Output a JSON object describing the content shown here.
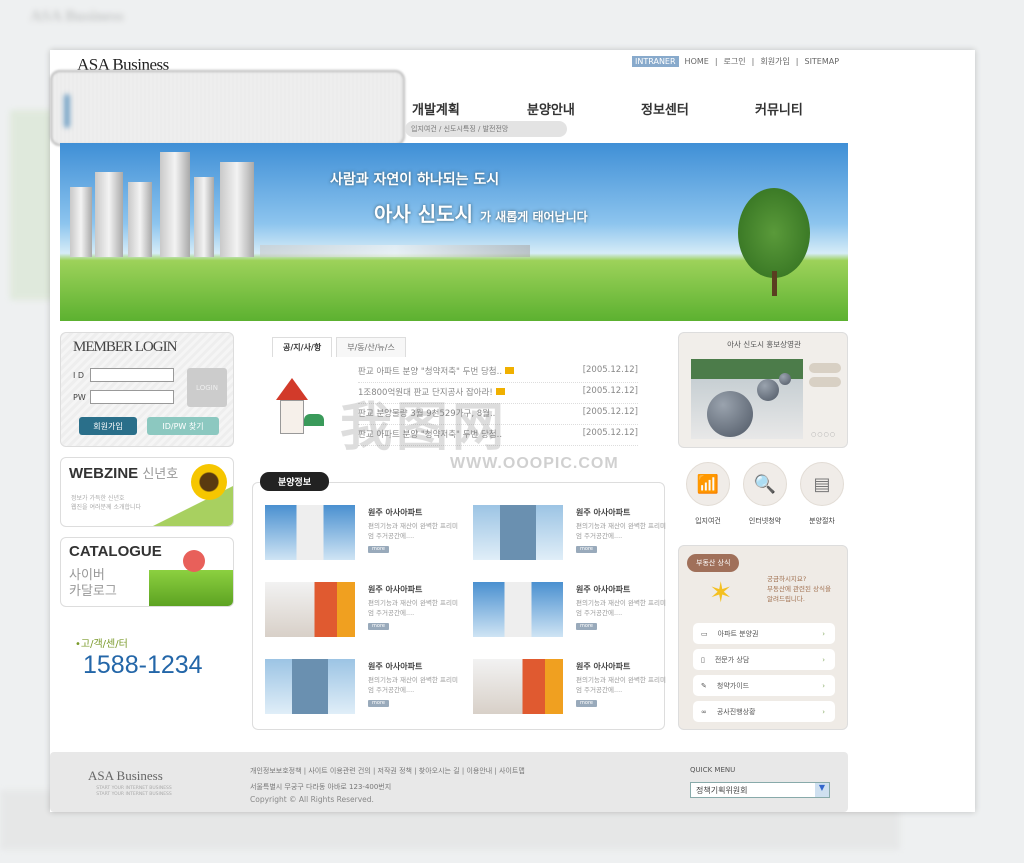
{
  "header": {
    "logo": "ASA Business",
    "top_links": [
      "INTRANER",
      "HOME",
      "로그인",
      "회원가입",
      "SITEMAP"
    ],
    "nav": [
      "개발계획",
      "분양안내",
      "정보센터",
      "커뮤니티"
    ],
    "subnav": "입지여건 / 신도시특징 / 발전전망"
  },
  "banner": {
    "line1": "사람과 자연이 하나되는 도시",
    "line2_big": "아사 신도시",
    "line2_small": "가 새롭게 태어납니다"
  },
  "login": {
    "title": "MEMBER LOGIN",
    "id_label": "I D",
    "pw_label": "PW",
    "login_button": "LOGIN",
    "join_button": "회원가입",
    "find_button": "ID/PW 찾기"
  },
  "webzine": {
    "title": "WEBZINE",
    "sub": "신년호",
    "desc1": "정보가 가득한 신년호",
    "desc2": "웹진을 여러분께 소개합니다"
  },
  "catalogue": {
    "title": "CATALOGUE",
    "sub1": "사이버",
    "sub2": "카달로그"
  },
  "callcenter": {
    "label": "•고/객/센/터",
    "phone": "1588-1234"
  },
  "notice": {
    "tabs": [
      "공/지/사/항",
      "부/동/산/뉴/스"
    ],
    "items": [
      {
        "title": "판교 아파트 분양 \"청약저축\" 두번 당첨..",
        "date": "[2005.12.12]",
        "new": true
      },
      {
        "title": "1조800억원대 판교 단지공사 잡아라!",
        "date": "[2005.12.12]",
        "new": true
      },
      {
        "title": "판교 분양물량 3월 9천529가구, 8월..",
        "date": "[2005.12.12]",
        "new": false
      },
      {
        "title": "판교 아파트 분양 \"청약저축\" 두번 당첨..",
        "date": "[2005.12.12]",
        "new": false
      }
    ]
  },
  "bunyang": {
    "label": "분양정보",
    "items": [
      {
        "title": "원주 아사아파트",
        "desc": "편의기능과 재산이 완벽한 프리미엄 주거공간에....",
        "btn": "more",
        "img": "building"
      },
      {
        "title": "원주 아사아파트",
        "desc": "편의기능과 재산이 완벽한 프리미엄 주거공간에....",
        "btn": "more",
        "img": "glass"
      },
      {
        "title": "원주 아사아파트",
        "desc": "편의기능과 재산이 완벽한 프리미엄 주거공간에....",
        "btn": "more",
        "img": "interior"
      },
      {
        "title": "원주 아사아파트",
        "desc": "편의기능과 재산이 완벽한 프리미엄 주거공간에....",
        "btn": "more",
        "img": "building"
      },
      {
        "title": "원주 아사아파트",
        "desc": "편의기능과 재산이 완벽한 프리미엄 주거공간에....",
        "btn": "more",
        "img": "glass"
      },
      {
        "title": "원주 아사아파트",
        "desc": "편의기능과 재산이 완벽한 프리미엄 주거공간에....",
        "btn": "more",
        "img": "interior"
      }
    ]
  },
  "promo": {
    "title": "아사 신도시 홍보상영관",
    "dots": "○○○○"
  },
  "quick_icons": [
    {
      "label": "입지여건",
      "icon": "signal-icon"
    },
    {
      "label": "인터넷청약",
      "icon": "monitor-search-icon"
    },
    {
      "label": "분양절차",
      "icon": "document-icon"
    }
  ],
  "info": {
    "bubble": "부동산 상식",
    "text1": "궁금하시지요?",
    "text2": "부동산에 관련된 상식을",
    "text3": "알려드립니다.",
    "items": [
      "아파트 분양권",
      "전문가 상담",
      "청약가이드",
      "공사진행상황"
    ]
  },
  "footer": {
    "logo": "ASA Business",
    "logo_sub1": "START YOUR INTERNET BUSINESS",
    "logo_sub2": "START YOUR INTERNET BUSINESS",
    "links": "개인정보보호정책 | 사이트 이용관련 건의 | 저작권 정책 | 찾아오시는 길 | 이용안내 | 사이트맵",
    "address": "서울특별시 무궁구 다라동 아바로 123-400번지",
    "copyright": "Copyright © All Rights Reserved.",
    "quick_menu_label": "QUICK MENU",
    "quick_menu_value": "정책기획위원회"
  },
  "watermark": {
    "main": "我图网",
    "url": "WWW.OOOPIC.COM"
  },
  "colors": {
    "accent_blue": "#2366a8",
    "join_button": "#2a6f8a",
    "find_button": "#8cc8c0"
  }
}
